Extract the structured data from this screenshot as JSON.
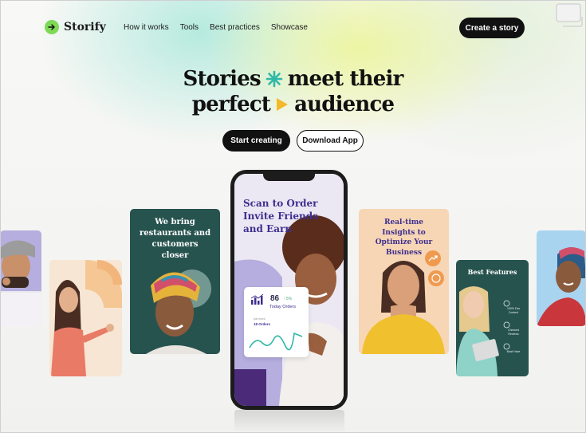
{
  "brand": {
    "name": "Storify",
    "accent": "#7ed957"
  },
  "nav": {
    "links": [
      "How it works",
      "Tools",
      "Best practices",
      "Showcase"
    ],
    "cta": "Create a story"
  },
  "hero": {
    "line1_a": "Stories",
    "line1_b": "meet their",
    "line2_a": "perfect",
    "line2_b": "audience",
    "primary_button": "Start creating",
    "secondary_button": "Download App"
  },
  "cards": {
    "restaurants": "We bring restaurants and customers closer",
    "insights": "Real-time Insights to Optimize Your Business",
    "features": {
      "title": "Best Features",
      "items": [
        "100% Fan Content",
        "Checked Reviews",
        "Must Have"
      ]
    }
  },
  "phone": {
    "title": "Scan to Order Invite Friends and Earn",
    "stat_value": "86",
    "stat_change": "↑ 5%",
    "stat_label": "Today Orders",
    "stat_sub_label": "last week",
    "stat_sub_value": "18 Orders"
  },
  "colors": {
    "teal": "#27534f",
    "purple": "#3d2f8f",
    "lavender": "#b5aede",
    "peach": "#f7d6b5",
    "arrow_yellow": "#f4b92a",
    "star_teal": "#2fb8a8"
  },
  "icons": [
    "logo-arrow-icon",
    "sparkle-icon",
    "play-triangle-icon",
    "chart-icon",
    "trend-icon",
    "dollar-icon",
    "window-icon"
  ]
}
